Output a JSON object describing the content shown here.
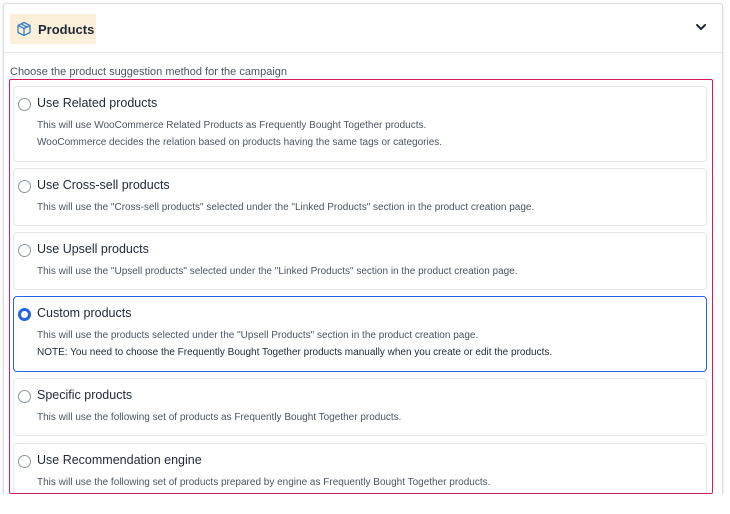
{
  "header": {
    "title": "Products",
    "icon": "box-icon",
    "toggle_icon": "chevron-down-icon"
  },
  "subtitle": "Choose the product suggestion method for the campaign",
  "colors": {
    "header_bg": "#fcefd9",
    "accent": "#2563eb",
    "highlight": "#d81b60"
  },
  "options": [
    {
      "title": "Use Related products",
      "selected": false,
      "lines": [
        "This will use WooCommerce Related Products as Frequently Bought Together products.",
        "WooCommerce decides the relation based on products having the same tags or categories."
      ]
    },
    {
      "title": "Use Cross-sell products",
      "selected": false,
      "lines": [
        "This will use the \"Cross-sell products\" selected under the \"Linked Products\" section in the product creation page."
      ]
    },
    {
      "title": "Use Upsell products",
      "selected": false,
      "lines": [
        "This will use the \"Upsell products\" selected under the \"Linked Products\" section in the product creation page."
      ]
    },
    {
      "title": "Custom products",
      "selected": true,
      "lines": [
        "This will use the products selected under the \"Upsell Products\" section in the product creation page.",
        "NOTE: You need to choose the Frequently Bought Together products manually when you create or edit the products."
      ]
    },
    {
      "title": "Specific products",
      "selected": false,
      "lines": [
        "This will use the following set of products as Frequently Bought Together products."
      ]
    },
    {
      "title": "Use Recommendation engine",
      "selected": false,
      "lines": [
        "This will use the following set of products prepared by engine as Frequently Bought Together products."
      ]
    }
  ]
}
